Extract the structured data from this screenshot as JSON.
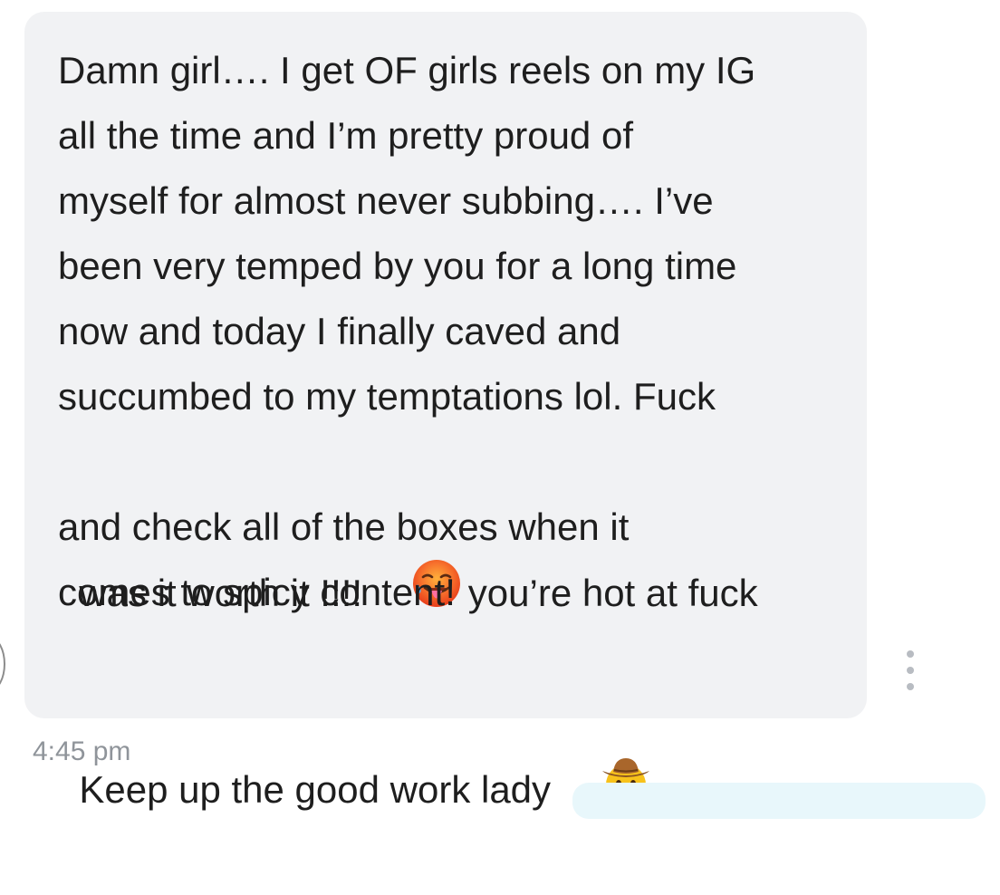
{
  "conversation": {
    "message": {
      "lines": {
        "l1": "Damn girl…. I get OF girls reels on my IG",
        "l2": "all the time and I’m pretty proud of",
        "l3": "myself for almost never subbing…. I’ve",
        "l4": "been very temped by you for a long time",
        "l5": "now and today I finally caved and",
        "l6": "succumbed to my temptations lol. Fuck",
        "l7a": "was it worth it !!!!",
        "l7b": "you’re hot at fuck",
        "l8": "and check all of the boxes when it",
        "l9": "comes to spicy content!",
        "l10": "Keep up the good work lady"
      },
      "emoji": {
        "hot_face": "hot-face-emoji",
        "cowboy": "cowboy-hat-face-emoji"
      },
      "timestamp": "4:45 pm"
    },
    "icons": {
      "more": "more-vertical-icon",
      "avatar": "avatar"
    },
    "colors": {
      "bubble_bg": "#f1f2f4",
      "text": "#1e1e1e",
      "timestamp": "#8f949a",
      "outgoing_bubble": "#e8f7fb"
    }
  }
}
